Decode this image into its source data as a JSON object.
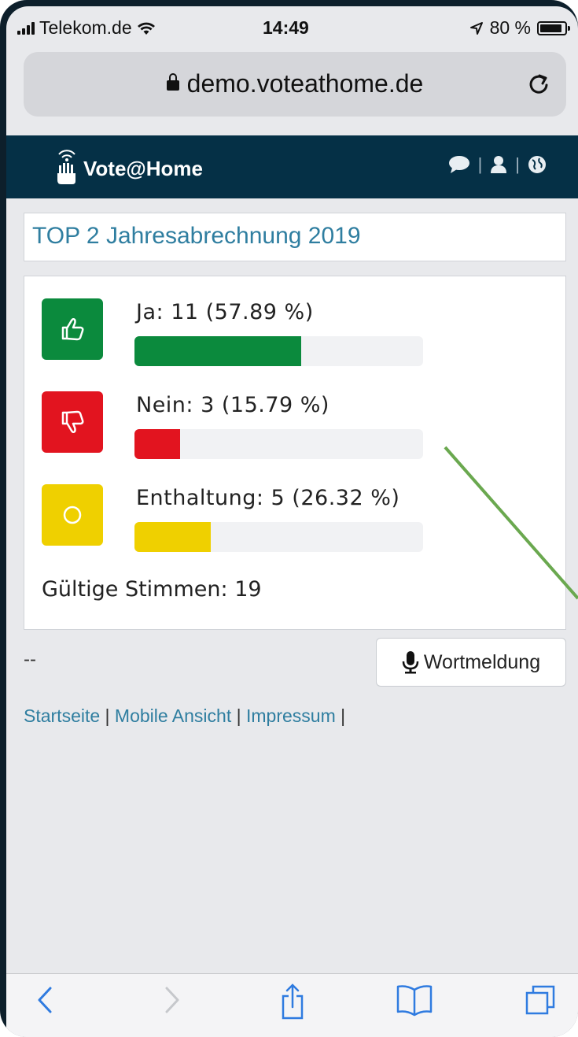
{
  "status_bar": {
    "carrier": "Telekom.de",
    "time": "14:49",
    "battery": "80 %",
    "battery_level": 0.8
  },
  "browser": {
    "domain": "demo.voteathome.de"
  },
  "app": {
    "brand": "Vote@Home"
  },
  "agenda": {
    "title": "TOP 2 Jahresabrechnung 2019"
  },
  "results": {
    "items": [
      {
        "label": "Ja: 11 (57.89 %)",
        "percent": 57.89,
        "color": "#0b8a3d",
        "icon": "thumbs-up-icon"
      },
      {
        "label": "Nein: 3 (15.79 %)",
        "percent": 15.79,
        "color": "#e2141f",
        "icon": "thumbs-down-icon"
      },
      {
        "label": "Enthaltung: 5 (26.32 %)",
        "percent": 26.32,
        "color": "#efd000",
        "icon": "circle-icon"
      }
    ],
    "valid_votes": "Gültige Stimmen: 19"
  },
  "bottom": {
    "dash": "--",
    "wortmeldung": "Wortmeldung"
  },
  "footer": {
    "links": [
      "Startseite",
      "Mobile Ansicht",
      "Impressum"
    ],
    "separator": "|"
  },
  "colors": {
    "header_bg": "#053046",
    "title_text": "#2f7ea0",
    "link": "#2f7ea0",
    "toolbar_icons": "#2f7be0",
    "annotation_line": "#6aa84f"
  }
}
